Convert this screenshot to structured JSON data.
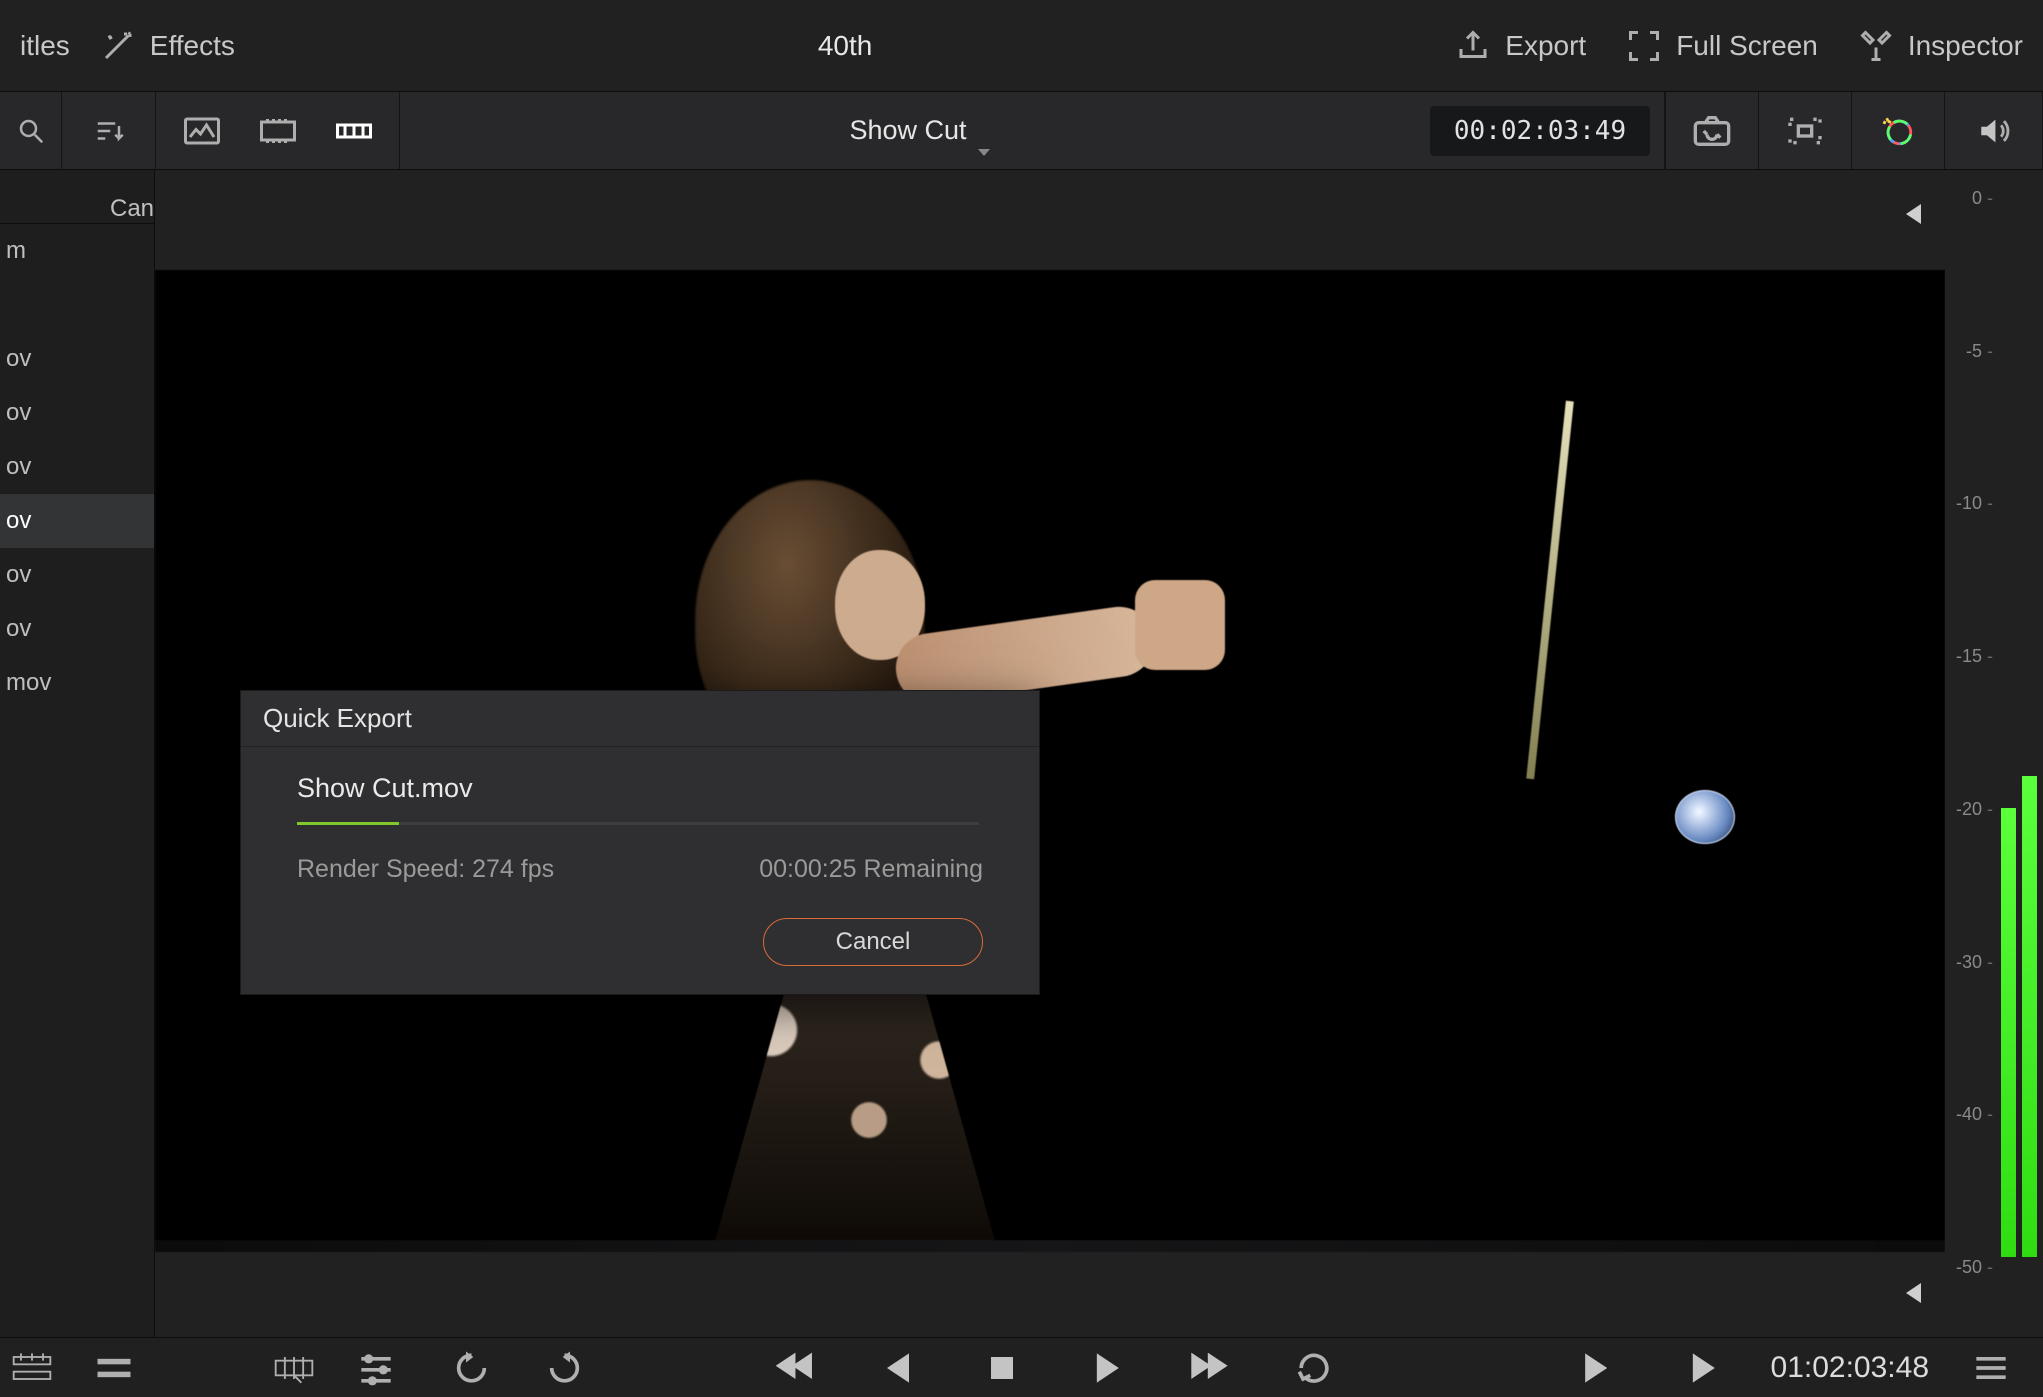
{
  "topbar": {
    "titles_label": "itles",
    "effects_label": "Effects",
    "project_title": "40th",
    "export_label": "Export",
    "fullscreen_label": "Full Screen",
    "inspector_label": "Inspector"
  },
  "toolbar": {
    "clip_title": "Show Cut",
    "timecode": "00:02:03:49"
  },
  "sidebar": {
    "tab_label": "Can",
    "items": [
      {
        "label": "m"
      },
      {
        "label": ""
      },
      {
        "label": "ov"
      },
      {
        "label": "ov"
      },
      {
        "label": "ov"
      },
      {
        "label": "ov"
      },
      {
        "label": "ov"
      },
      {
        "label": "ov"
      },
      {
        "label": "mov"
      }
    ],
    "selected_index": 5
  },
  "meters": {
    "ticks": [
      "0",
      "-5",
      "-10",
      "-15",
      "-20",
      "-30",
      "-40",
      "-50"
    ]
  },
  "modal": {
    "title": "Quick Export",
    "filename": "Show Cut.mov",
    "progress_pct": 15,
    "render_speed": "Render Speed: 274 fps",
    "remaining": "00:00:25 Remaining",
    "cancel_label": "Cancel"
  },
  "transport": {
    "timecode": "01:02:03:48"
  }
}
